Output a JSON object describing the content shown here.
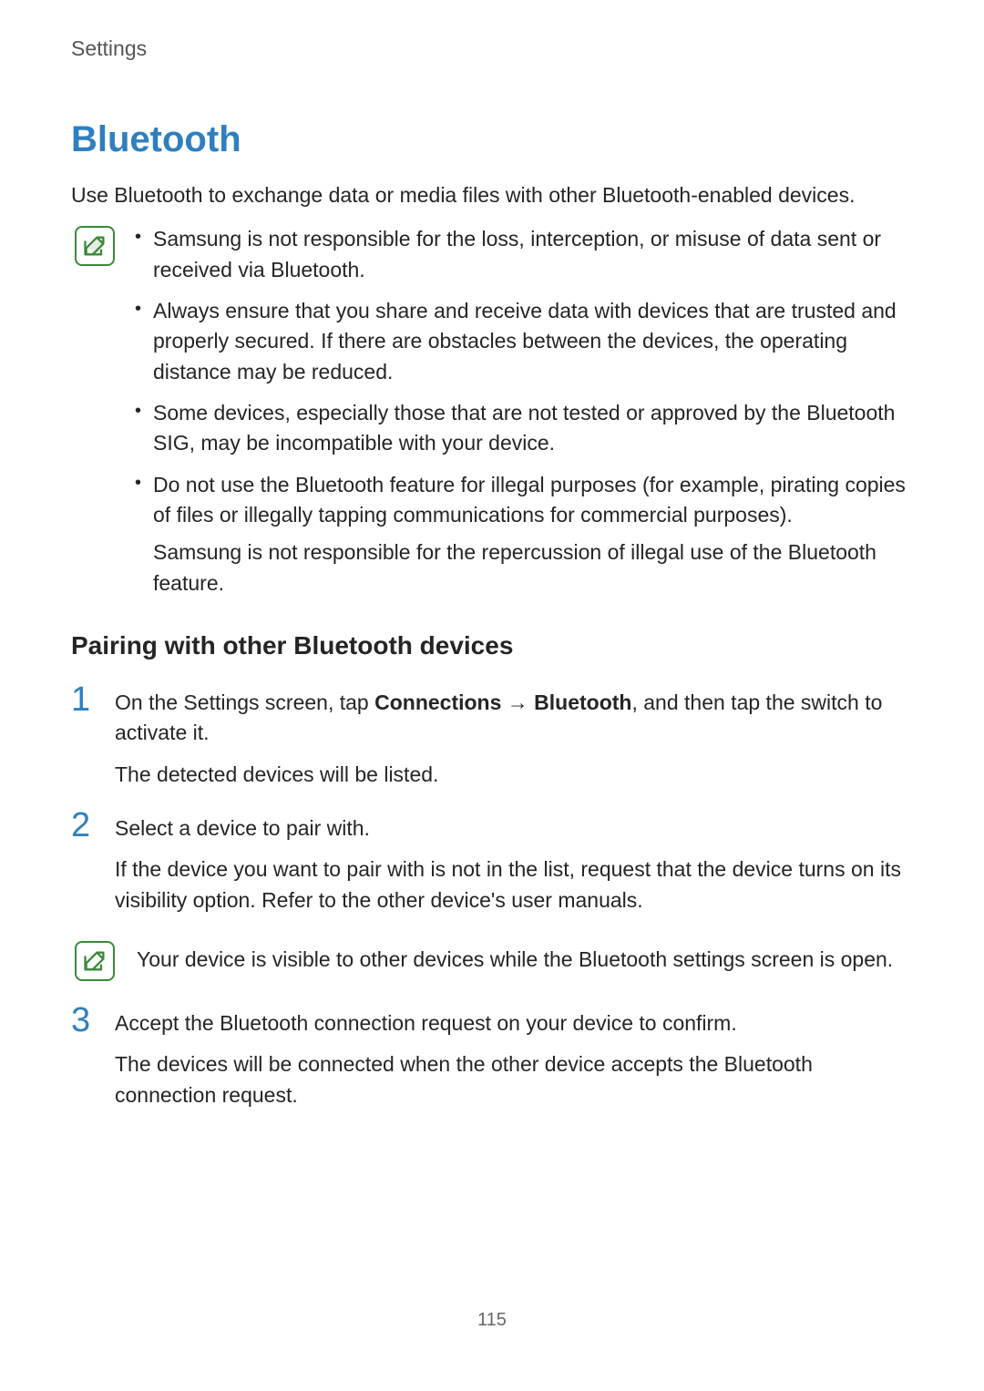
{
  "header": {
    "section": "Settings"
  },
  "title": "Bluetooth",
  "intro": "Use Bluetooth to exchange data or media files with other Bluetooth-enabled devices.",
  "notes": {
    "items": [
      "Samsung is not responsible for the loss, interception, or misuse of data sent or received via Bluetooth.",
      "Always ensure that you share and receive data with devices that are trusted and properly secured. If there are obstacles between the devices, the operating distance may be reduced.",
      "Some devices, especially those that are not tested or approved by the Bluetooth SIG, may be incompatible with your device.",
      "Do not use the Bluetooth feature for illegal purposes (for example, pirating copies of files or illegally tapping communications for commercial purposes)."
    ],
    "item4_sub": "Samsung is not responsible for the repercussion of illegal use of the Bluetooth feature."
  },
  "subheading": "Pairing with other Bluetooth devices",
  "steps": {
    "s1": {
      "num": "1",
      "line_pre": "On the Settings screen, tap ",
      "bold1": "Connections",
      "arrow": " → ",
      "bold2": "Bluetooth",
      "line_post": ", and then tap the switch to activate it.",
      "para2": "The detected devices will be listed."
    },
    "s2": {
      "num": "2",
      "line1": "Select a device to pair with.",
      "para2": "If the device you want to pair with is not in the list, request that the device turns on its visibility option. Refer to the other device's user manuals."
    },
    "s3": {
      "num": "3",
      "line1": "Accept the Bluetooth connection request on your device to confirm.",
      "para2": "The devices will be connected when the other device accepts the Bluetooth connection request."
    }
  },
  "inline_note": "Your device is visible to other devices while the Bluetooth settings screen is open.",
  "page_number": "115"
}
